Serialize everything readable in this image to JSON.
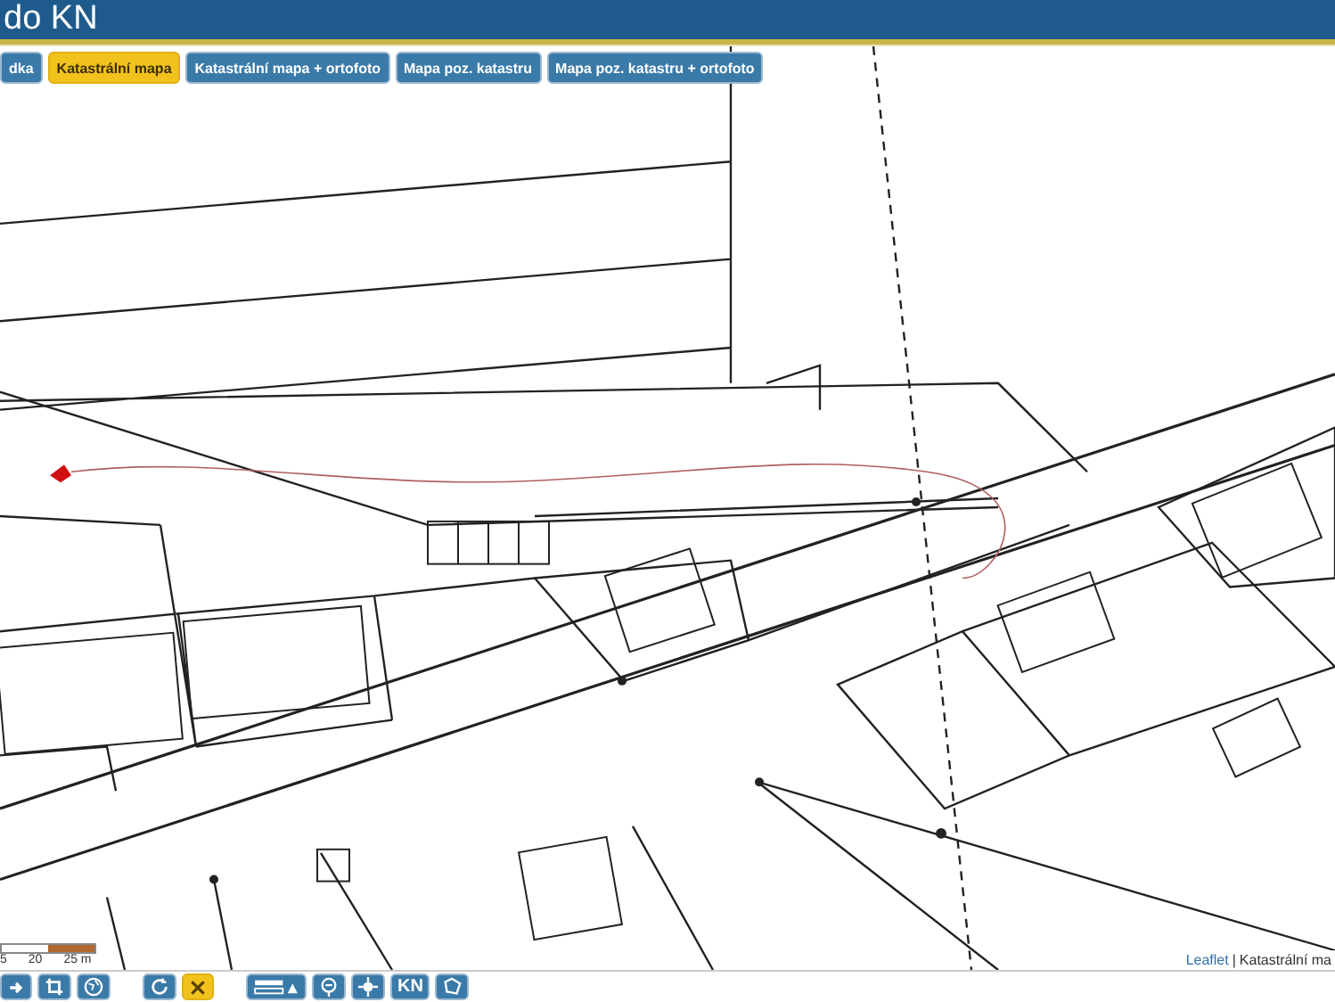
{
  "header": {
    "title": "do KN"
  },
  "layers": [
    {
      "label": "dka",
      "selected": false
    },
    {
      "label": "Katastrální mapa",
      "selected": true
    },
    {
      "label": "Katastrální mapa + ortofoto",
      "selected": false
    },
    {
      "label": "Mapa poz. katastru",
      "selected": false
    },
    {
      "label": "Mapa poz. katastru + ortofoto",
      "selected": false
    }
  ],
  "scale": {
    "labels": [
      "5",
      "20",
      "25 m"
    ]
  },
  "attribution": {
    "link": "Leaflet",
    "separator": "|",
    "text": "Katastrální ma"
  },
  "toolbar": [
    {
      "kind": "icon",
      "selected": false
    },
    {
      "kind": "icon",
      "selected": false
    },
    {
      "kind": "icon",
      "selected": false
    },
    {
      "kind": "icon",
      "selected": false
    },
    {
      "kind": "icon",
      "selected": true
    },
    {
      "kind": "icon",
      "selected": false
    },
    {
      "kind": "icon",
      "selected": false
    },
    {
      "kind": "icon",
      "selected": false
    },
    {
      "kind": "text",
      "label": "KN",
      "selected": false
    },
    {
      "kind": "icon",
      "selected": false
    }
  ]
}
